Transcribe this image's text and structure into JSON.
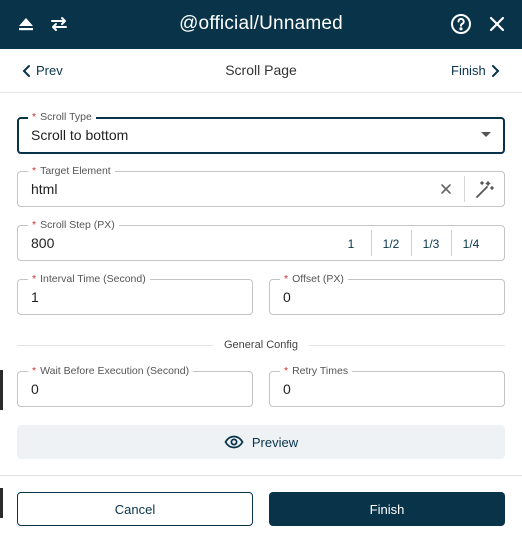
{
  "header": {
    "title": "@official/Unnamed",
    "icons": [
      "eject-icon",
      "swap-icon",
      "help-icon",
      "close-icon"
    ]
  },
  "subnav": {
    "prev_label": "Prev",
    "page_title": "Scroll Page",
    "finish_label": "Finish"
  },
  "form": {
    "required_mark": "*",
    "scroll_type": {
      "label": "Scroll Type",
      "value": "Scroll to bottom"
    },
    "target_element": {
      "label": "Target Element",
      "value": "html"
    },
    "scroll_step": {
      "label": "Scroll Step (PX)",
      "value": "800",
      "options": [
        "1",
        "1/2",
        "1/3",
        "1/4"
      ]
    },
    "interval_time": {
      "label": "Interval Time (Second)",
      "value": "1"
    },
    "offset": {
      "label": "Offset (PX)",
      "value": "0"
    },
    "general_config": "General Config",
    "wait_before": {
      "label": "Wait Before Execution (Second)",
      "value": "0"
    },
    "retry_times": {
      "label": "Retry Times",
      "value": "0"
    }
  },
  "actions": {
    "preview": "Preview",
    "cancel": "Cancel",
    "finish": "Finish"
  },
  "colors": {
    "primary": "#083349",
    "required": "#d32f2f",
    "preview_bg": "#eef2f5"
  }
}
